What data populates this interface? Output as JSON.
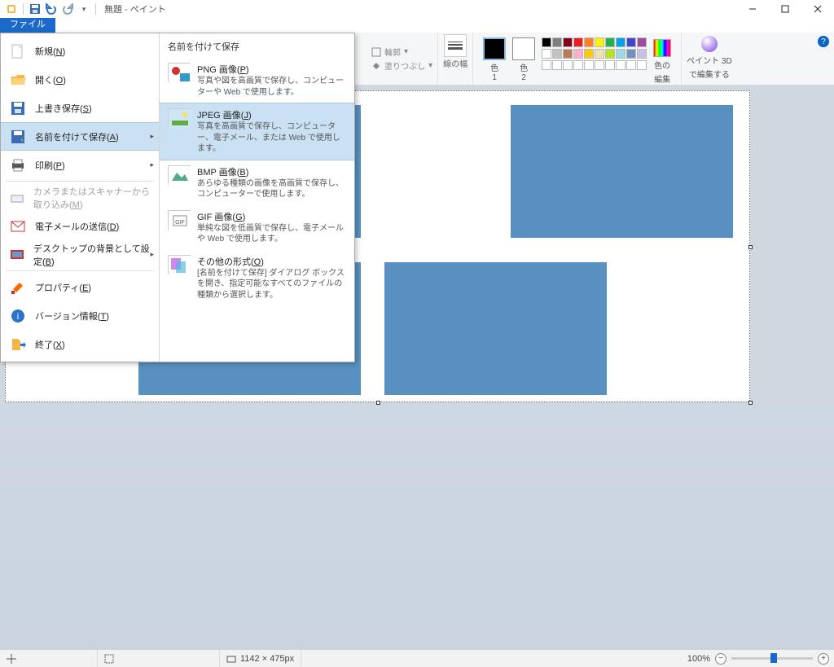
{
  "title": "無題 - ペイント",
  "tabs": {
    "file": "ファイル"
  },
  "ribbon": {
    "outline_label": "輪郭",
    "fill_label": "塗りつぶし",
    "line_width_label": "線の幅",
    "color1_label_a": "色",
    "color1_label_b": "1",
    "color2_label_a": "色",
    "color2_label_b": "2",
    "palette_label": "色",
    "edit_colors_a": "色の",
    "edit_colors_b": "編集",
    "paint3d_a": "ペイント 3D",
    "paint3d_b": "で編集する"
  },
  "palette_colors": {
    "row1": [
      "#000000",
      "#7f7f7f",
      "#880015",
      "#ed1c24",
      "#ff7f27",
      "#fff200",
      "#22b14c",
      "#00a2e8",
      "#3f48cc",
      "#a349a4"
    ],
    "row2": [
      "#ffffff",
      "#c3c3c3",
      "#b97a57",
      "#ffaec9",
      "#ffc90e",
      "#efe4b0",
      "#b5e61d",
      "#99d9ea",
      "#7092be",
      "#c8bfe7"
    ],
    "row3": [
      "#ffffff",
      "#ffffff",
      "#ffffff",
      "#ffffff",
      "#ffffff",
      "#ffffff",
      "#ffffff",
      "#ffffff",
      "#ffffff",
      "#ffffff"
    ]
  },
  "file_menu": {
    "items": [
      {
        "label": "新規(<u class='ak'>N</u>)",
        "icon": "new"
      },
      {
        "label": "開く(<u class='ak'>O</u>)",
        "icon": "open"
      },
      {
        "label": "上書き保存(<u class='ak'>S</u>)",
        "icon": "save"
      },
      {
        "label": "名前を付けて保存(<u class='ak'>A</u>)",
        "icon": "saveas",
        "hasSub": true,
        "selected": true
      },
      {
        "label": "印刷(<u class='ak'>P</u>)",
        "icon": "print",
        "hasSub": true
      },
      {
        "label": "カメラまたはスキャナーから取り込み(<u class='ak'>M</u>)",
        "icon": "scan",
        "disabled": true
      },
      {
        "label": "電子メールの送信(<u class='ak'>D</u>)",
        "icon": "mail"
      },
      {
        "label": "デスクトップの背景として設定(<u class='ak'>B</u>)",
        "icon": "wallpaper",
        "hasSub": true
      },
      {
        "label": "プロパティ(<u class='ak'>E</u>)",
        "icon": "prop"
      },
      {
        "label": "バージョン情報(<u class='ak'>T</u>)",
        "icon": "about"
      },
      {
        "label": "終了(<u class='ak'>X</u>)",
        "icon": "exit"
      }
    ],
    "right_title": "名前を付けて保存",
    "formats": [
      {
        "title": "PNG 画像(<u class='ak'>P</u>)",
        "desc": "写真や図を高画質で保存し、コンピューターや Web で使用します。"
      },
      {
        "title": "JPEG 画像(<u class='ak'>J</u>)",
        "desc": "写真を高画質で保存し、コンピューター、電子メール、または Web で使用します。",
        "highlight": true
      },
      {
        "title": "BMP 画像(<u class='ak'>B</u>)",
        "desc": "あらゆる種類の画像を高画質で保存し、コンピューターで使用します。"
      },
      {
        "title": "GIF 画像(<u class='ak'>G</u>)",
        "desc": "単純な図を低画質で保存し、電子メールや Web で使用します。"
      },
      {
        "title": "その他の形式(<u class='ak'>O</u>)",
        "desc": "[名前を付けて保存] ダイアログ ボックスを開き、指定可能なすべてのファイルの種類から選択します。"
      }
    ]
  },
  "status": {
    "canvas_size": "1142 × 475px",
    "zoom": "100%"
  },
  "colors": {
    "current1": "#000000",
    "current2": "#ffffff"
  }
}
